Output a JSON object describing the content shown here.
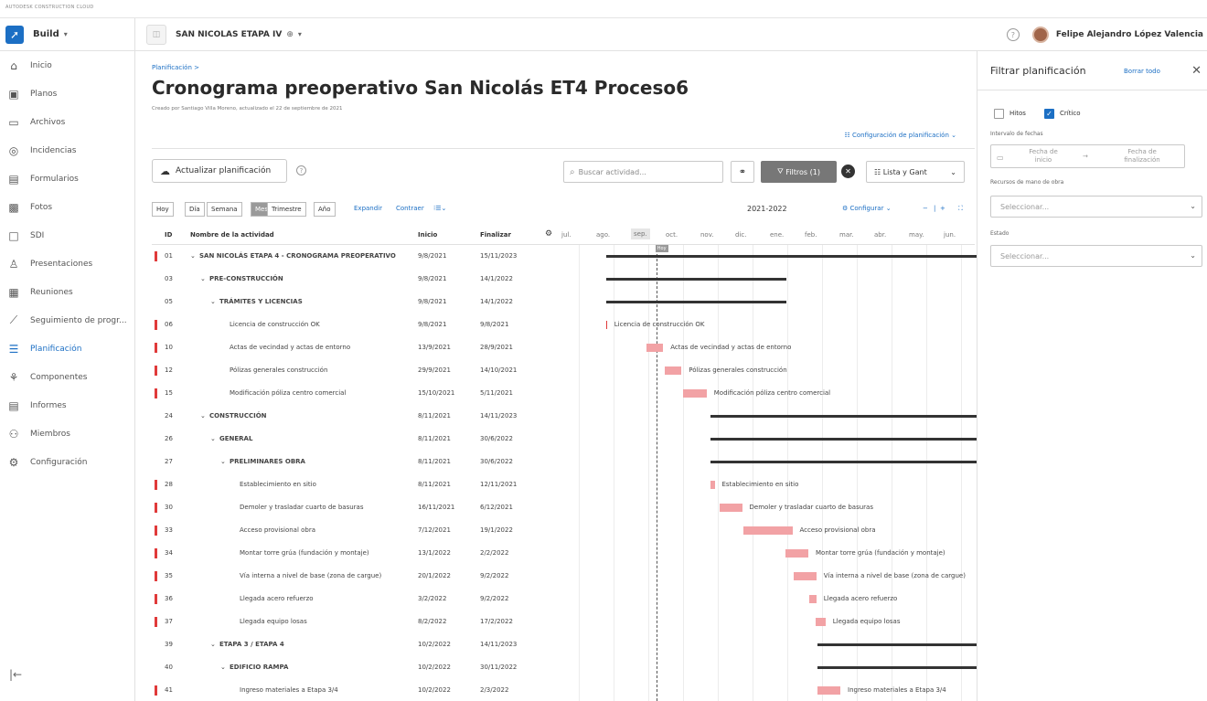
{
  "brand": "AUTODESK CONSTRUCTION CLOUD",
  "header": {
    "app_label": "Build",
    "project_name": "SAN NICOLAS ETAPA IV",
    "user_name": "Felipe Alejandro López Valencia"
  },
  "sidebar": {
    "items": [
      {
        "label": "Inicio",
        "icon": "home-icon",
        "glyph": "⌂"
      },
      {
        "label": "Planos",
        "icon": "sheets-icon",
        "glyph": "▣"
      },
      {
        "label": "Archivos",
        "icon": "folder-icon",
        "glyph": "▭"
      },
      {
        "label": "Incidencias",
        "icon": "issues-icon",
        "glyph": "◎"
      },
      {
        "label": "Formularios",
        "icon": "forms-icon",
        "glyph": "▤"
      },
      {
        "label": "Fotos",
        "icon": "photos-icon",
        "glyph": "▩"
      },
      {
        "label": "SDI",
        "icon": "rfi-icon",
        "glyph": "□"
      },
      {
        "label": "Presentaciones",
        "icon": "submittals-icon",
        "glyph": "♙"
      },
      {
        "label": "Reuniones",
        "icon": "meetings-icon",
        "glyph": "▦"
      },
      {
        "label": "Seguimiento de progr...",
        "icon": "progress-icon",
        "glyph": "⟋"
      },
      {
        "label": "Planificación",
        "icon": "schedule-icon",
        "glyph": "☰",
        "active": true
      },
      {
        "label": "Componentes",
        "icon": "assets-icon",
        "glyph": "⚘"
      },
      {
        "label": "Informes",
        "icon": "reports-icon",
        "glyph": "▤"
      },
      {
        "label": "Miembros",
        "icon": "members-icon",
        "glyph": "⚇"
      },
      {
        "label": "Configuración",
        "icon": "settings-icon",
        "glyph": "⚙"
      }
    ]
  },
  "main": {
    "breadcrumb": "Planificación  >",
    "title": "Cronograma preoperativo San Nicolás ET4 Proceso6",
    "created_by": "Creado por Santiago Villa Moreno, actualizado el 22 de septiembre de 2021",
    "config_link": "Configuración de planificación",
    "update_button": "Actualizar planificación",
    "search_placeholder": "Buscar actividad...",
    "filters_label": "Filtros (1)",
    "view_select": "Lista y Gant",
    "segments": [
      "Hoy",
      "Día",
      "Semana",
      "Mes",
      "Trimestre",
      "Año"
    ],
    "expand": "Expandir",
    "collapse": "Contraer",
    "year_label": "2021-2022",
    "configure": "Configurar",
    "today_tag": "Hoy"
  },
  "columns": {
    "id": "ID",
    "name": "Nombre de la actividad",
    "start": "Inicio",
    "end": "Finalizar"
  },
  "months": [
    "jul.",
    "ago.",
    "sep.",
    "oct.",
    "nov.",
    "dic.",
    "ene.",
    "feb.",
    "mar.",
    "abr.",
    "may.",
    "jun."
  ],
  "rows": [
    {
      "id": "01",
      "name": "SAN NICOLÁS ETAPA 4 - CRONOGRAMA PREOPERATIVO",
      "start": "9/8/2021",
      "end": "15/11/2023",
      "level": 0,
      "summary": true,
      "critical": true
    },
    {
      "id": "03",
      "name": "PRE-CONSTRUCCIÓN",
      "start": "9/8/2021",
      "end": "14/1/2022",
      "level": 1,
      "summary": true,
      "critical": false
    },
    {
      "id": "05",
      "name": "TRÁMITES Y LICENCIAS",
      "start": "9/8/2021",
      "end": "14/1/2022",
      "level": 2,
      "summary": true,
      "critical": false
    },
    {
      "id": "06",
      "name": "Licencia de construcción OK",
      "start": "9/8/2021",
      "end": "9/8/2021",
      "level": 3,
      "summary": false,
      "critical": true
    },
    {
      "id": "10",
      "name": "Actas de vecindad y actas de entorno",
      "start": "13/9/2021",
      "end": "28/9/2021",
      "level": 3,
      "summary": false,
      "critical": true
    },
    {
      "id": "12",
      "name": "Pólizas generales construcción",
      "start": "29/9/2021",
      "end": "14/10/2021",
      "level": 3,
      "summary": false,
      "critical": true
    },
    {
      "id": "15",
      "name": "Modificación póliza centro comercial",
      "start": "15/10/2021",
      "end": "5/11/2021",
      "level": 3,
      "summary": false,
      "critical": true
    },
    {
      "id": "24",
      "name": "CONSTRUCCIÓN",
      "start": "8/11/2021",
      "end": "14/11/2023",
      "level": 1,
      "summary": true,
      "critical": false
    },
    {
      "id": "26",
      "name": "GENERAL",
      "start": "8/11/2021",
      "end": "30/6/2022",
      "level": 2,
      "summary": true,
      "critical": false
    },
    {
      "id": "27",
      "name": "PRELIMINARES OBRA",
      "start": "8/11/2021",
      "end": "30/6/2022",
      "level": 3,
      "summary": true,
      "critical": false
    },
    {
      "id": "28",
      "name": "Establecimiento en sitio",
      "start": "8/11/2021",
      "end": "12/11/2021",
      "level": 4,
      "summary": false,
      "critical": true
    },
    {
      "id": "30",
      "name": "Demoler y trasladar cuarto de basuras",
      "start": "16/11/2021",
      "end": "6/12/2021",
      "level": 4,
      "summary": false,
      "critical": true
    },
    {
      "id": "33",
      "name": "Acceso provisional obra",
      "start": "7/12/2021",
      "end": "19/1/2022",
      "level": 4,
      "summary": false,
      "critical": true
    },
    {
      "id": "34",
      "name": "Montar torre grúa (fundación y montaje)",
      "start": "13/1/2022",
      "end": "2/2/2022",
      "level": 4,
      "summary": false,
      "critical": true
    },
    {
      "id": "35",
      "name": "Vía interna a nivel de base (zona de cargue)",
      "start": "20/1/2022",
      "end": "9/2/2022",
      "level": 4,
      "summary": false,
      "critical": true
    },
    {
      "id": "36",
      "name": "Llegada acero refuerzo",
      "start": "3/2/2022",
      "end": "9/2/2022",
      "level": 4,
      "summary": false,
      "critical": true
    },
    {
      "id": "37",
      "name": "Llegada equipo losas",
      "start": "8/2/2022",
      "end": "17/2/2022",
      "level": 4,
      "summary": false,
      "critical": true
    },
    {
      "id": "39",
      "name": "ETAPA 3 / ETAPA 4",
      "start": "10/2/2022",
      "end": "14/11/2023",
      "level": 2,
      "summary": true,
      "critical": false
    },
    {
      "id": "40",
      "name": "EDIFICIO RAMPA",
      "start": "10/2/2022",
      "end": "30/11/2022",
      "level": 3,
      "summary": true,
      "critical": false
    },
    {
      "id": "41",
      "name": "Ingreso materiales a Etapa 3/4",
      "start": "10/2/2022",
      "end": "2/3/2022",
      "level": 4,
      "summary": false,
      "critical": true
    }
  ],
  "filter_panel": {
    "title": "Filtrar planificación",
    "clear_all": "Borrar todo",
    "milestones_label": "Hitos",
    "milestones_checked": false,
    "critical_label": "Crítico",
    "critical_checked": true,
    "date_range_label": "Intervalo de fechas",
    "start_date_placeholder": "Fecha de inicio",
    "end_date_placeholder": "Fecha de finalización",
    "labor_label": "Recursos de mano de obra",
    "labor_placeholder": "Seleccionar...",
    "status_label": "Estado",
    "status_placeholder": "Seleccionar..."
  }
}
